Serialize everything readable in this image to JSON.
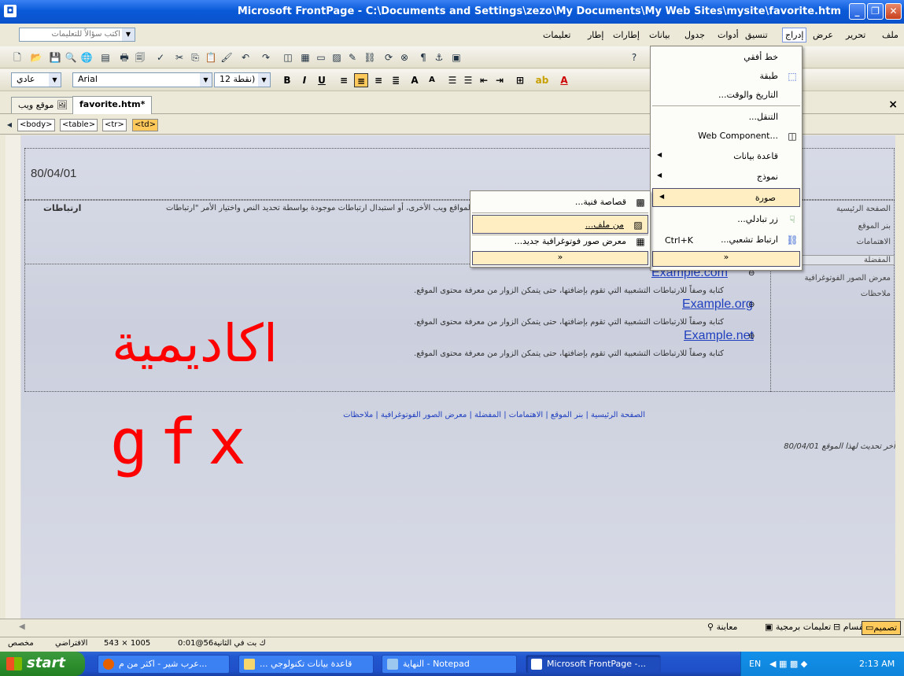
{
  "window": {
    "title": "Microsoft FrontPage - C:\\Documents and Settings\\zezo\\My Documents\\My Web Sites\\mysite\\favorite.htm"
  },
  "menubar": {
    "items": [
      "ملف",
      "تحرير",
      "عرض",
      "إدراج",
      "تنسيق",
      "أدوات",
      "جدول",
      "بيانات",
      "إطارات",
      "إطار",
      "تعليمات"
    ],
    "ask_placeholder": "اكتب سؤالاً للتعليمات"
  },
  "format": {
    "style": "عادي",
    "font": "Arial",
    "size": "12 نقطة)"
  },
  "tabs": {
    "site": "موقع ويب",
    "file": "favorite.htm*"
  },
  "tags": [
    "<body>",
    "<table>",
    "<tr>",
    "<td>"
  ],
  "page": {
    "date_top": "80/04/01",
    "intro": "لمواقع ويب الأخرى، أو استبدال ارتباطات موجودة بواسطة تحديد النص واختيار الأمر \"ارتباطات",
    "big_arabic": "اكاديمية",
    "gfx": "gfx",
    "nav": [
      "الصفحة الرئيسية",
      "بنر الموقع",
      "الاهتمامات",
      "المفضلة",
      "معرض الصور الفوتوغرافية",
      "ملاحظات"
    ],
    "links": [
      {
        "url": "Example.com",
        "desc": "كتابة وصفاً للارتباطات التشعبية التي تقوم بإضافتها، حتى يتمكن الزوار من معرفة محتوى الموقع."
      },
      {
        "url": "Example.org",
        "desc": "كتابة وصفاً للارتباطات التشعبية التي تقوم بإضافتها، حتى يتمكن الزوار من معرفة محتوى الموقع."
      },
      {
        "url": "Example.net",
        "desc": "كتابة وصفاً للارتباطات التشعبية التي تقوم بإضافتها، حتى يتمكن الزوار من معرفة محتوى الموقع."
      }
    ],
    "footer_nav": "الصفحة الرئيسية | بنر الموقع | الاهتمامات | المفضلة | معرض الصور الفوتوغرافية | ملاحظات",
    "last_update": "آخر تحديث لهذا الموقع 80/04/01"
  },
  "insert_menu": {
    "items": [
      {
        "label": "خط أفقي",
        "icon": "horizontal-line-icon"
      },
      {
        "label": "طبقة",
        "icon": "layer-icon"
      },
      {
        "label": "التاريخ والوقت...",
        "icon": ""
      },
      {
        "label": "التنقل...",
        "icon": ""
      },
      {
        "label": "Web Component...",
        "icon": "web-component-icon"
      },
      {
        "label": "قاعدة بيانات",
        "icon": ""
      },
      {
        "label": "نموذج",
        "icon": ""
      },
      {
        "label": "صورة",
        "icon": ""
      },
      {
        "label": "زر تبادلي...",
        "icon": "interactive-button-icon"
      },
      {
        "label": "ارتباط تشعبي...",
        "icon": "hyperlink-icon",
        "shortcut": "Ctrl+K"
      }
    ]
  },
  "picture_menu": {
    "items": [
      {
        "label": "قصاصة فنية...",
        "icon": "clip-art-icon"
      },
      {
        "label": "من ملف...",
        "icon": "from-file-icon"
      },
      {
        "label": "معرض صور فوتوغرافية جديد...",
        "icon": "photo-gallery-icon"
      }
    ]
  },
  "viewtabs": [
    "تصميم",
    "انقسام",
    "تعليمات برمجية",
    "معاينة"
  ],
  "status": {
    "time": "0:01@56ك بت في الثانية",
    "size": "543 × 1005",
    "mode": "الافتراضي",
    "custom": "مخصص"
  },
  "taskbar": {
    "start": "start",
    "tasks": [
      "عرب شير - اكثر من م...",
      "... قاعدة بيانات تكنولوجي",
      "النهاية - Notepad",
      "Microsoft FrontPage -..."
    ],
    "lang": "EN",
    "clock": "2:13 AM"
  },
  "colors": {
    "accent_red": "#ff0000",
    "link_blue": "#1f3fbf",
    "highlight": "#ffc95c"
  }
}
